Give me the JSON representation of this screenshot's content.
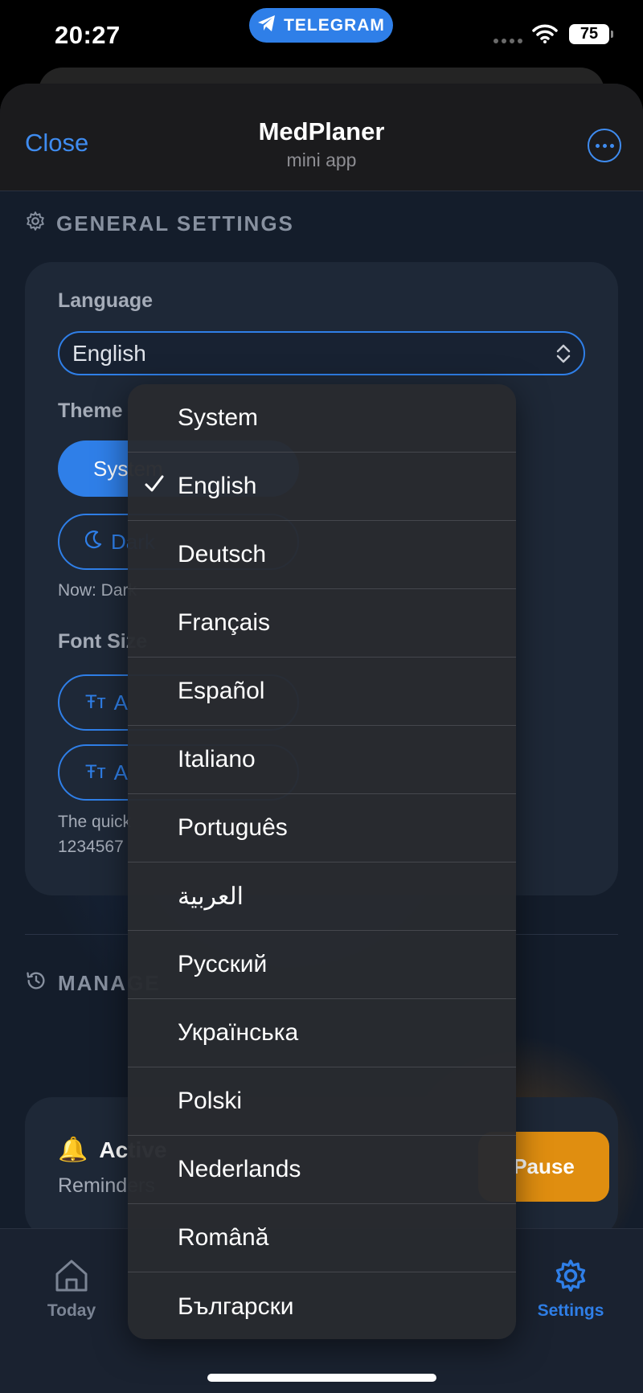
{
  "status_bar": {
    "time": "20:27",
    "telegram_label": "TELEGRAM",
    "battery": "75"
  },
  "header": {
    "close_label": "Close",
    "title": "MedPlaner",
    "subtitle": "mini app"
  },
  "general": {
    "section_title": "GENERAL SETTINGS",
    "language_label": "Language",
    "language_value": "English",
    "theme_label": "Theme",
    "theme_system": "System",
    "theme_dark": "Dark",
    "theme_now": "Now: Dark",
    "font_size_label": "Font Size",
    "font_option_1": "A",
    "font_option_2": "A",
    "sample_line_1": "The quick",
    "sample_line_2": "1234567"
  },
  "manage": {
    "section_title": "MANAGE",
    "reminder_title": "Active",
    "reminder_sub": "Reminders",
    "pause_label": "Pause"
  },
  "tabbar": {
    "today_label": "Today",
    "settings_label": "Settings"
  },
  "dropdown": {
    "selected": "English",
    "options": [
      "System",
      "English",
      "Deutsch",
      "Français",
      "Español",
      "Italiano",
      "Português",
      "العربية",
      "Русский",
      "Українська",
      "Polski",
      "Nederlands",
      "Română",
      "Български"
    ]
  },
  "colors": {
    "accent": "#2f7fe8",
    "pause": "#e08e10",
    "background": "#141d2b"
  }
}
